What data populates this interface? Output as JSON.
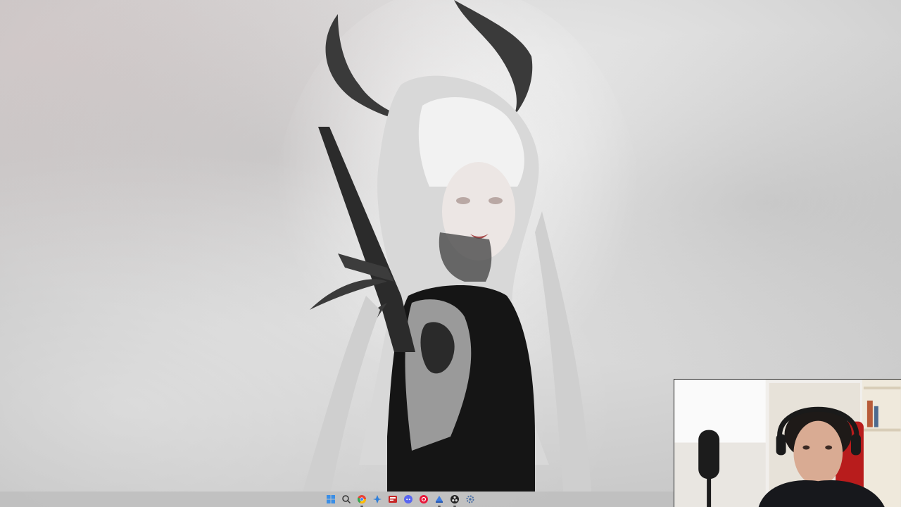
{
  "taskbar": {
    "icons": [
      {
        "name": "start-icon",
        "color": "#3a8ee6",
        "running": false
      },
      {
        "name": "search-icon",
        "color": "#333333",
        "running": false
      },
      {
        "name": "chrome-icon",
        "color": "#e94235",
        "running": true
      },
      {
        "name": "copilot-icon",
        "color": "#2f7fd9",
        "running": false
      },
      {
        "name": "app-red-icon",
        "color": "#c62828",
        "running": false
      },
      {
        "name": "discord-icon",
        "color": "#5865f2",
        "running": false
      },
      {
        "name": "music-icon",
        "color": "#e8173a",
        "running": false
      },
      {
        "name": "app-blue-icon",
        "color": "#3d7be0",
        "running": true
      },
      {
        "name": "obs-icon",
        "color": "#222222",
        "running": true
      },
      {
        "name": "settings-icon",
        "color": "#4a6fa5",
        "running": false
      }
    ]
  },
  "colors": {
    "taskbar": "#bebebe",
    "wallpaper": "#d6d6d6"
  }
}
